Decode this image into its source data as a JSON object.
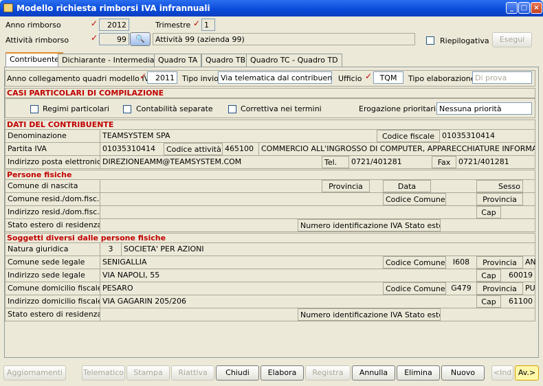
{
  "window": {
    "title": "Modello richiesta rimborsi IVA infrannuali"
  },
  "top": {
    "anno_label": "Anno rimborso",
    "anno_value": "2012",
    "trimestre_label": "Trimestre",
    "trimestre_value": "1",
    "attivita_label": "Attività rimborso",
    "attivita_value": "99",
    "attivita_desc": "Attività 99 (azienda 99)",
    "riepilogativa_label": "Riepilogativa",
    "esegui_label": "Esegui"
  },
  "tabs": [
    "Contribuente",
    "Dichiarante - Intermediario",
    "Quadro TA",
    "Quadro TB",
    "Quadro TC - Quadro TD"
  ],
  "row1": {
    "anno_coll_label": "Anno collegamento quadri modello IVA",
    "anno_coll_value": "2011",
    "tipo_invio_label": "Tipo invio",
    "tipo_invio_value": "Via telematica dal contribuente",
    "ufficio_label": "Ufficio",
    "ufficio_value": "TQM",
    "tipo_elab_label": "Tipo elaborazione",
    "tipo_elab_value": "Di prova"
  },
  "casi": {
    "header": "CASI PARTICOLARI DI COMPILAZIONE",
    "regimi": "Regimi particolari",
    "contabilita": "Contabilità separate",
    "correttiva": "Correttiva nei termini",
    "erogazione_label": "Erogazione prioritaria",
    "erogazione_value": "Nessuna priorità"
  },
  "dati": {
    "header": "DATI DEL CONTRIBUENTE",
    "denominazione_label": "Denominazione",
    "denominazione": "TEAMSYSTEM SPA",
    "cf_label": "Codice fiscale",
    "cf": "01035310414",
    "piva_label": "Partita IVA",
    "piva": "01035310414",
    "cod_att_label": "Codice attività",
    "cod_att": "465100",
    "att_desc": "COMMERCIO ALL'INGROSSO DI COMPUTER, APPARECCHIATURE INFORMATICHE",
    "pec_label": "Indirizzo posta elettronica",
    "pec": "DIREZIONEAMM@TEAMSYSTEM.COM",
    "tel_label": "Tel.",
    "tel": "0721/401281",
    "fax_label": "Fax",
    "fax": "0721/401281"
  },
  "pf": {
    "header": "Persone fisiche",
    "comune_nascita": "Comune di nascita",
    "provincia": "Provincia",
    "data": "Data",
    "sesso": "Sesso",
    "comune_resid": "Comune resid./dom.fisc.",
    "codice_comune": "Codice Comune",
    "provincia2": "Provincia",
    "indirizzo_resid": "Indirizzo resid./dom.fisc.",
    "cap": "Cap",
    "stato_estero": "Stato estero di residenza",
    "num_iva_estero": "Numero identificazione IVA Stato estero"
  },
  "sd": {
    "header": "Soggetti diversi dalle persone fisiche",
    "natura_label": "Natura giuridica",
    "natura_code": "3",
    "natura_desc": "SOCIETA' PER AZIONI",
    "comune_sede_label": "Comune sede legale",
    "comune_sede": "SENIGALLIA",
    "cod_comune_label": "Codice Comune",
    "cod_comune_sede": "I608",
    "provincia_label": "Provincia",
    "prov_sede": "AN",
    "ind_sede_label": "Indirizzo sede legale",
    "ind_sede": "VIA NAPOLI, 55",
    "cap_label": "Cap",
    "cap_sede": "60019",
    "comune_dom_label": "Comune domicilio fiscale",
    "comune_dom": "PESARO",
    "cod_comune_dom": "G479",
    "prov_dom": "PU",
    "ind_dom_label": "Indirizzo domicilio fiscale",
    "ind_dom": "VIA GAGARIN 205/206",
    "cap_dom": "61100",
    "stato_estero": "Stato estero di residenza",
    "num_iva_estero": "Numero identificazione IVA Stato estero"
  },
  "buttons": [
    "Aggiornamenti",
    "Telematico",
    "Stampa",
    "Riattiva",
    "Chiudi",
    "Elabora",
    "Registra",
    "Annulla",
    "Elimina",
    "Nuovo",
    "<Ind",
    "Av.>"
  ]
}
